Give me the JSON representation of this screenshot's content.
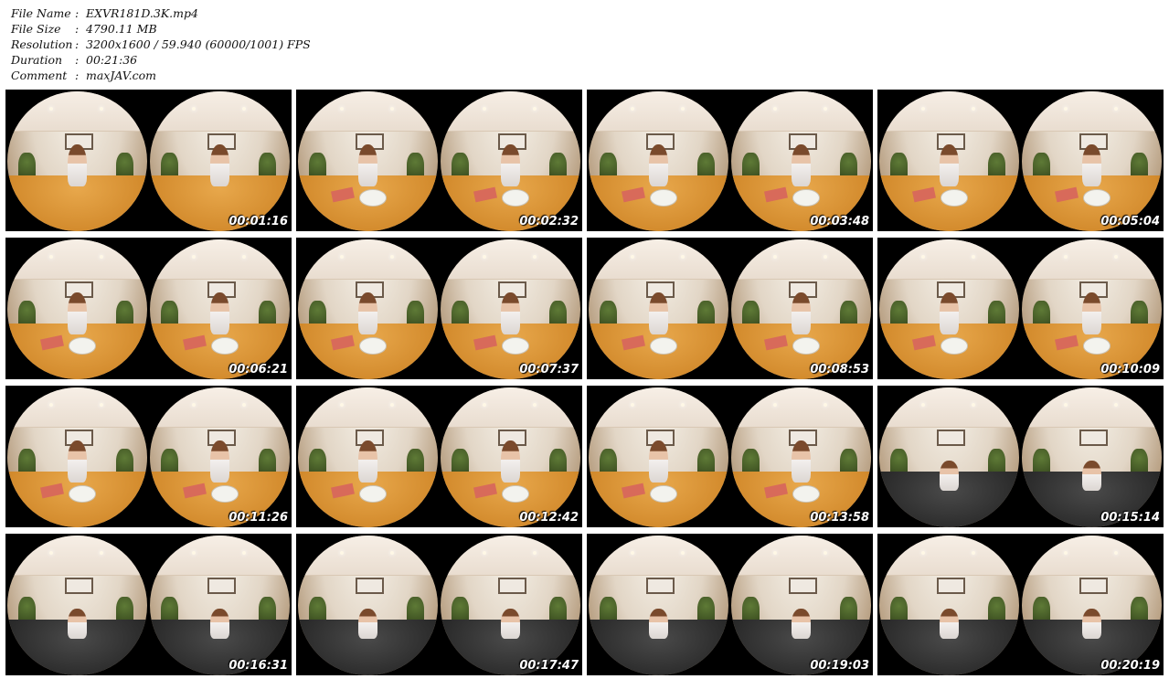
{
  "meta": {
    "file_name_label": "File Name",
    "file_name": "EXVR181D.3K.mp4",
    "file_size_label": "File Size",
    "file_size": "4790.11 MB",
    "resolution_label": "Resolution",
    "resolution": "3200x1600 / 59.940 (60000/1001) FPS",
    "duration_label": "Duration",
    "duration": "00:21:36",
    "comment_label": "Comment",
    "comment": "maxJAV.com",
    "separator": ":"
  },
  "thumbnails": [
    {
      "time": "00:01:16"
    },
    {
      "time": "00:02:32"
    },
    {
      "time": "00:03:48"
    },
    {
      "time": "00:05:04"
    },
    {
      "time": "00:06:21"
    },
    {
      "time": "00:07:37"
    },
    {
      "time": "00:08:53"
    },
    {
      "time": "00:10:09"
    },
    {
      "time": "00:11:26"
    },
    {
      "time": "00:12:42"
    },
    {
      "time": "00:13:58"
    },
    {
      "time": "00:15:14"
    },
    {
      "time": "00:16:31"
    },
    {
      "time": "00:17:47"
    },
    {
      "time": "00:19:03"
    },
    {
      "time": "00:20:19"
    }
  ]
}
